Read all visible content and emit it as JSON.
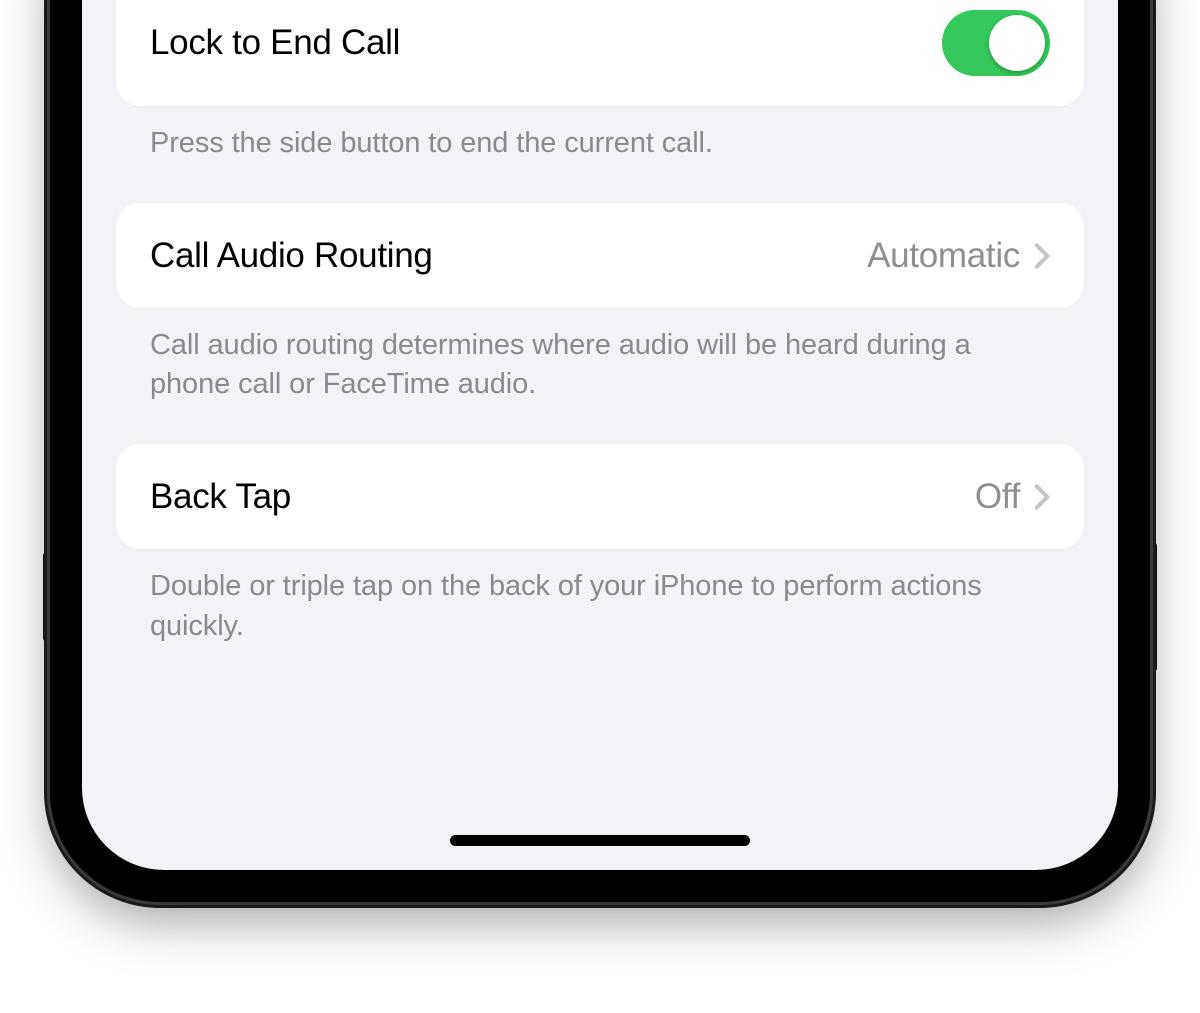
{
  "colors": {
    "toggle_on": "#34c759",
    "screen_bg": "#f2f2f7",
    "cell_bg": "#ffffff",
    "secondary_text": "#8a8a8e",
    "value_text": "#8e8e93"
  },
  "settings": [
    {
      "key": "lock_to_end_call",
      "label": "Lock to End Call",
      "type": "toggle",
      "state": "on",
      "footer": "Press the side button to end the current call."
    },
    {
      "key": "call_audio_routing",
      "label": "Call Audio Routing",
      "type": "nav",
      "value": "Automatic",
      "footer": "Call audio routing determines where audio will be heard during a phone call or FaceTime audio."
    },
    {
      "key": "back_tap",
      "label": "Back Tap",
      "type": "nav",
      "value": "Off",
      "footer": "Double or triple tap on the back of your iPhone to perform actions quickly."
    }
  ]
}
